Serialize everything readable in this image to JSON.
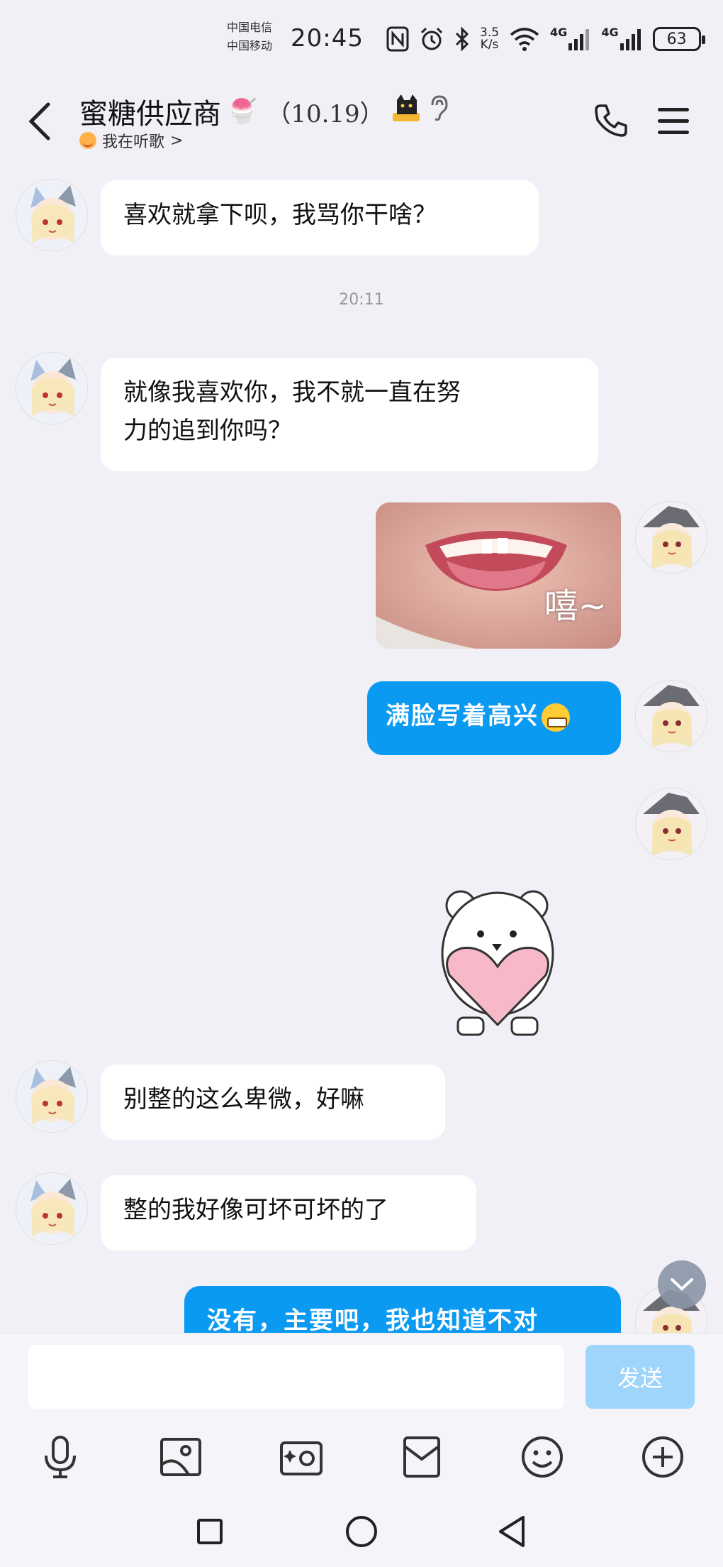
{
  "status_bar": {
    "carrier_1": "中国电信",
    "carrier_2": "中国移动",
    "time": "20:45",
    "net_speed_value": "3.5",
    "net_speed_unit": "K/s",
    "signal_1_label": "4G",
    "signal_2_label": "4G",
    "battery": "63"
  },
  "header": {
    "title": "蜜糖供应商",
    "title_emoji_1": "🍧",
    "group_count": "（10.19）",
    "status_text": "我在听歌",
    "status_arrow": ">"
  },
  "messages": {
    "m1": "喜欢就拿下呗，我骂你干啥？",
    "timestamp_1": "20:11",
    "m2_line1": "就像我喜欢你，我不就一直在努",
    "m2_line2": "力的追到你吗？",
    "photo_caption": "嘻~",
    "m3": "满脸写着高兴",
    "m4": "别整的这么卑微，好嘛",
    "m5": "整的我好像可坏可坏的了",
    "m6": "没有，主要吧，我也知道不对"
  },
  "input": {
    "placeholder": "",
    "send_label": "发送"
  },
  "colors": {
    "outgoing_bubble": "#0b9af2",
    "incoming_bubble": "#ffffff",
    "background": "#f0f0f6",
    "send_disabled": "#9fd4fb"
  },
  "icons": {
    "toolbar": [
      "microphone-icon",
      "image-icon",
      "camera-icon",
      "red-packet-icon",
      "emoji-icon",
      "plus-icon"
    ],
    "nav": [
      "recent-apps-icon",
      "home-icon",
      "back-nav-icon"
    ]
  }
}
